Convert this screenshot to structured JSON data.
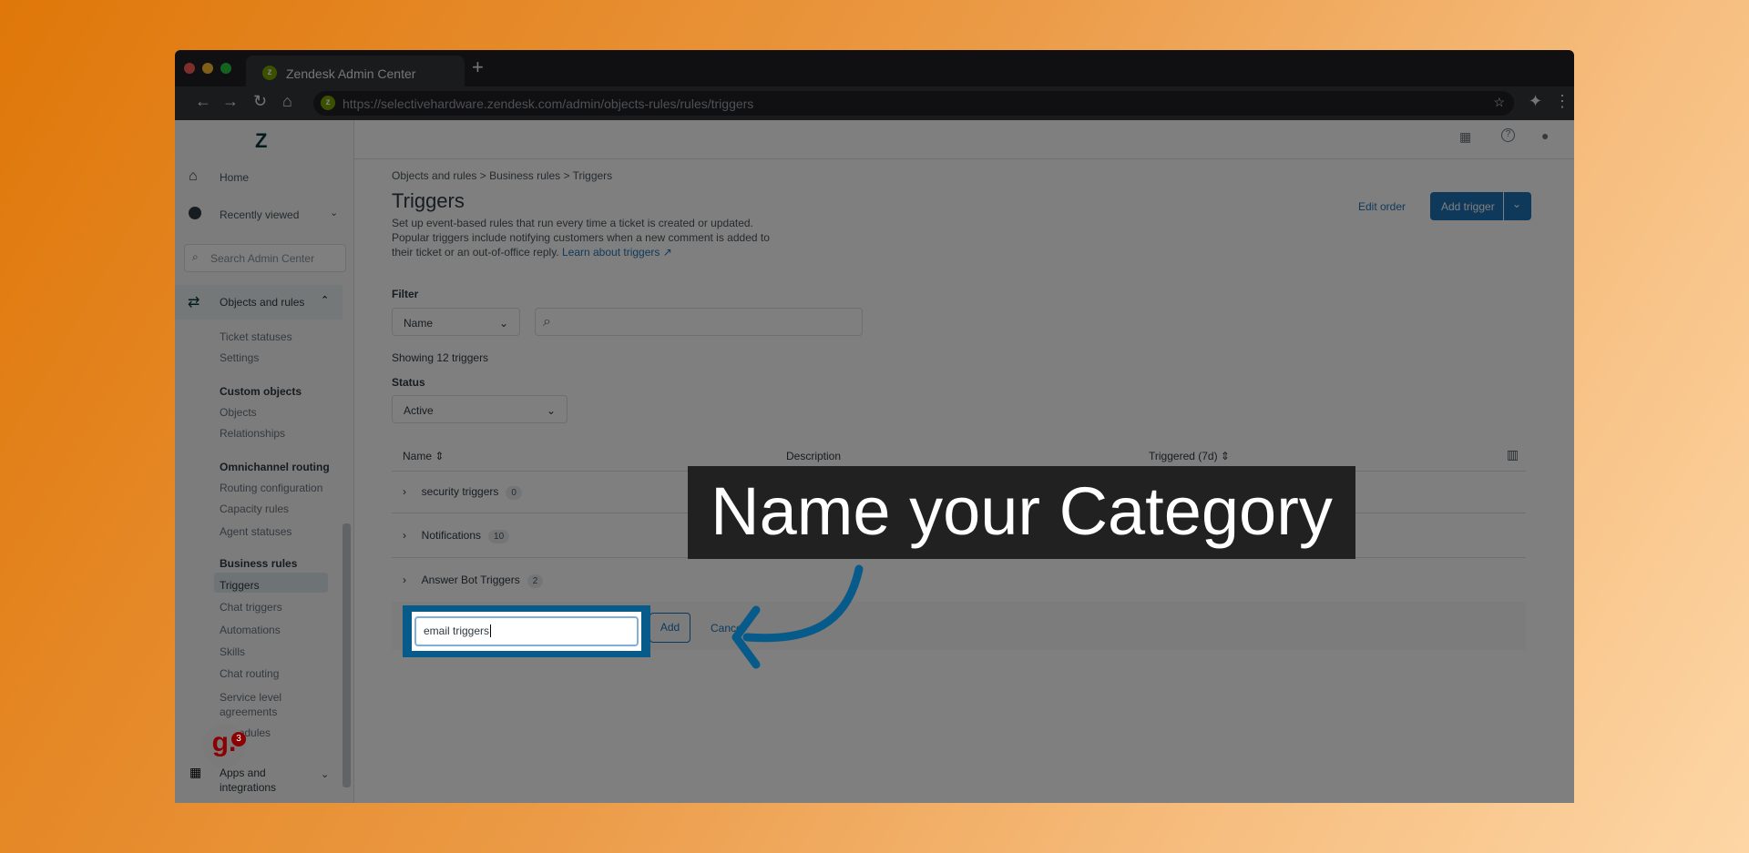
{
  "browser": {
    "tab_title": "Zendesk Admin Center",
    "url": "https://selectivehardware.zendesk.com/admin/objects-rules/rules/triggers"
  },
  "sidebar": {
    "search_placeholder": "Search Admin Center",
    "home": "Home",
    "recently_viewed": "Recently viewed",
    "objects_and_rules": "Objects and rules",
    "items": [
      "Ticket statuses",
      "Settings"
    ],
    "custom_objects": {
      "heading": "Custom objects",
      "items": [
        "Objects",
        "Relationships"
      ]
    },
    "omnichannel": {
      "heading": "Omnichannel routing",
      "items": [
        "Routing configuration",
        "Capacity rules",
        "Agent statuses"
      ]
    },
    "business_rules": {
      "heading": "Business rules",
      "items": [
        "Triggers",
        "Chat triggers",
        "Automations",
        "Skills",
        "Chat routing",
        "Service level agreements",
        "Schedules"
      ]
    },
    "apps": "Apps and integrations",
    "notification_count": "3",
    "widget_letter": "g."
  },
  "breadcrumb": [
    "Objects and rules",
    "Business rules",
    "Triggers"
  ],
  "page": {
    "title": "Triggers",
    "description": "Set up event-based rules that run every time a ticket is created or updated. Popular triggers include notifying customers when a new comment is added to their ticket or an out-of-office reply.",
    "learn_link": "Learn about triggers",
    "edit_order": "Edit order",
    "add_trigger": "Add trigger"
  },
  "filter": {
    "label": "Filter",
    "select": "Name",
    "search_value": "",
    "showing": "Showing 12 triggers",
    "status_label": "Status",
    "status_value": "Active"
  },
  "table": {
    "columns": [
      "Name",
      "Description",
      "Triggered (7d)"
    ],
    "rows": [
      {
        "name": "security triggers",
        "count": "0"
      },
      {
        "name": "Notifications",
        "count": "10"
      },
      {
        "name": "Answer Bot Triggers",
        "count": "2"
      }
    ]
  },
  "new_category": {
    "value": "email triggers",
    "add": "Add",
    "cancel": "Cancel"
  },
  "callout": {
    "text": "Name your Category",
    "color": "#212121",
    "arrow_color": "#065b8a"
  }
}
